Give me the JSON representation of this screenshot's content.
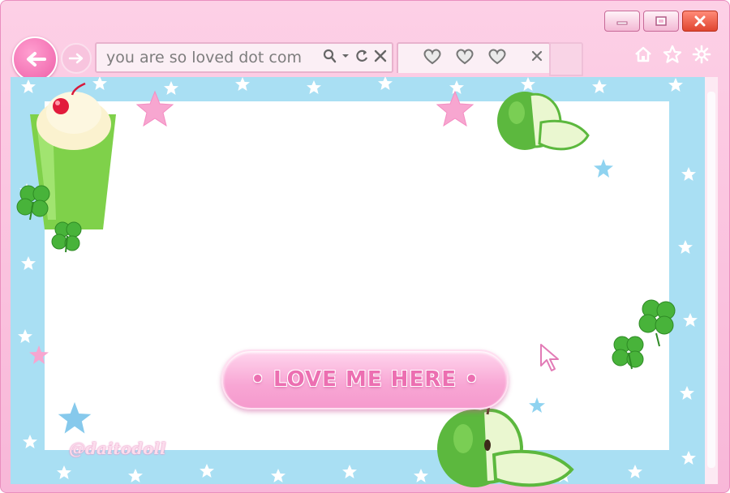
{
  "window": {
    "buttons": [
      "minimize",
      "maximize",
      "close"
    ]
  },
  "nav": {
    "address": "you are so loved dot com",
    "tab_hearts": [
      "heart",
      "heart",
      "heart"
    ],
    "right_icons": [
      "home-icon",
      "star-icon",
      "gear-icon"
    ]
  },
  "page": {
    "cta_label": "• LOVE ME HERE •",
    "watermark": "@daitodoll"
  },
  "colors": {
    "frame_pink": "#f8b7d8",
    "viewport_blue": "#a9dff3",
    "button_pink": "#f8a6d4",
    "label_pink": "#ec6fb1",
    "apple_green": "#5cb83e"
  }
}
